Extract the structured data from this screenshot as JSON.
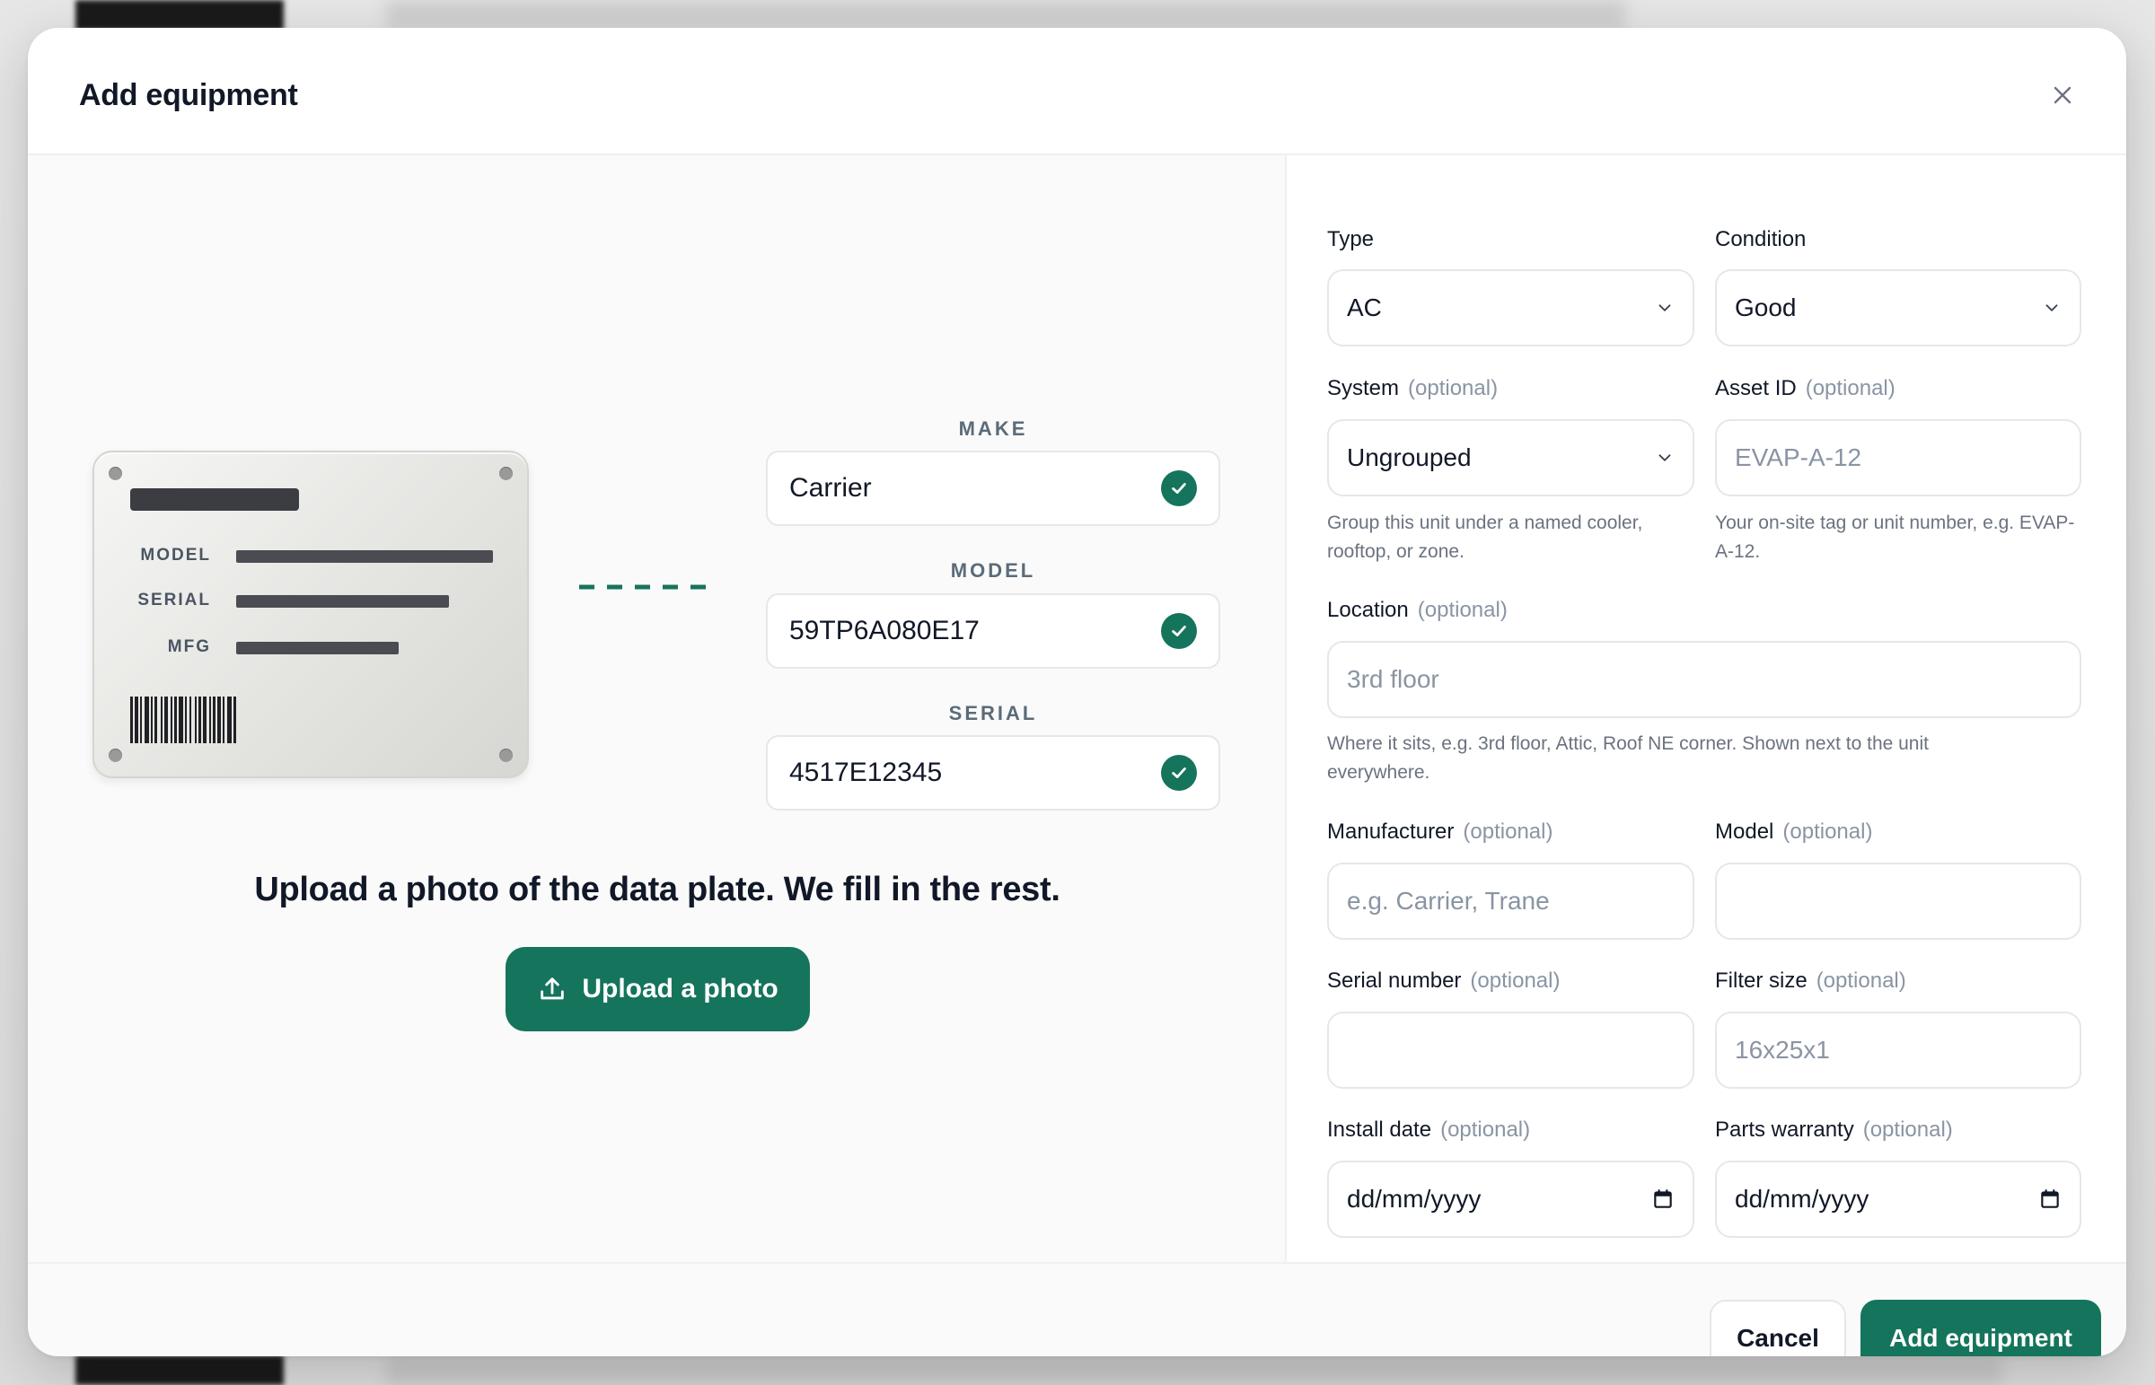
{
  "modal": {
    "title": "Add equipment"
  },
  "plate": {
    "labels": [
      "MODEL",
      "SERIAL",
      "MFG"
    ]
  },
  "ocr": {
    "make": {
      "label": "MAKE",
      "value": "Carrier"
    },
    "model": {
      "label": "MODEL",
      "value": "59TP6A080E17"
    },
    "serial": {
      "label": "SERIAL",
      "value": "4517E12345"
    }
  },
  "upload": {
    "tagline": "Upload a photo of the data plate. We fill in the rest.",
    "button_label": "Upload a photo"
  },
  "form": {
    "optional_tag": "(optional)",
    "type": {
      "label": "Type",
      "value": "AC"
    },
    "condition": {
      "label": "Condition",
      "value": "Good"
    },
    "system": {
      "label": "System",
      "value": "Ungrouped",
      "help": "Group this unit under a named cooler, rooftop, or zone."
    },
    "asset_id": {
      "label": "Asset ID",
      "placeholder": "EVAP-A-12",
      "help": "Your on-site tag or unit number, e.g. EVAP-A-12."
    },
    "location": {
      "label": "Location",
      "placeholder": "3rd floor",
      "help": "Where it sits, e.g. 3rd floor, Attic, Roof NE corner. Shown next to the unit everywhere."
    },
    "manufacturer": {
      "label": "Manufacturer",
      "placeholder": "e.g. Carrier, Trane"
    },
    "model": {
      "label": "Model",
      "placeholder": ""
    },
    "serial_number": {
      "label": "Serial number",
      "placeholder": ""
    },
    "filter_size": {
      "label": "Filter size",
      "placeholder": "16x25x1"
    },
    "install_date": {
      "label": "Install date",
      "placeholder": "dd/mm/yyyy"
    },
    "parts_warranty": {
      "label": "Parts warranty",
      "placeholder": "dd/mm/yyyy"
    }
  },
  "footer": {
    "cancel_label": "Cancel",
    "submit_label": "Add equipment"
  },
  "colors": {
    "accent": "#15745c",
    "border": "#e5e7eb",
    "muted_text": "#8a94a3"
  }
}
